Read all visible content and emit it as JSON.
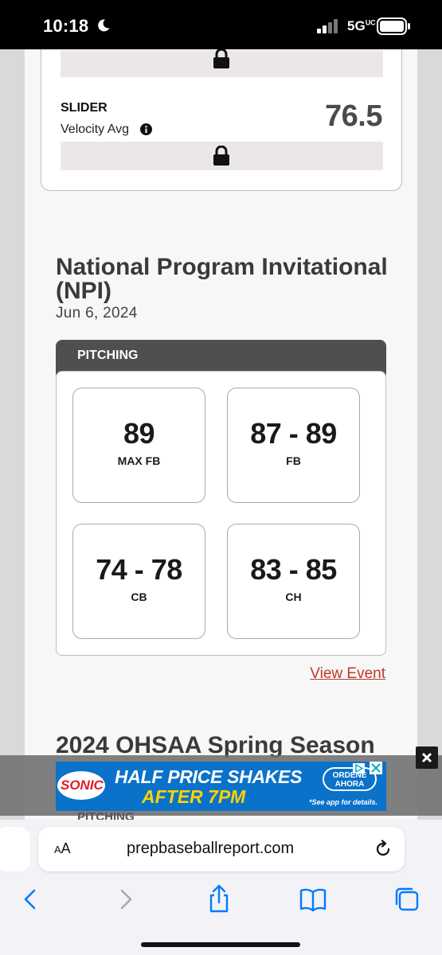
{
  "status_bar": {
    "time": "10:18",
    "network": "5G",
    "network_superscript": "UC"
  },
  "slider_metric": {
    "name": "SLIDER",
    "subtitle": "Velocity Avg",
    "value": "76.5"
  },
  "event": {
    "title": "National Program Invitational (NPI)",
    "date": "Jun 6, 2024",
    "section_label": "PITCHING",
    "stats": [
      {
        "value": "89",
        "label": "MAX FB"
      },
      {
        "value": "87 - 89",
        "label": "FB"
      },
      {
        "value": "74 - 78",
        "label": "CB"
      },
      {
        "value": "83 - 85",
        "label": "CH"
      }
    ],
    "link_label": "View Event"
  },
  "next_event": {
    "title": "2024 OHSAA Spring Season",
    "section_label_partial": "PITCHING"
  },
  "ad": {
    "brand": "SONIC",
    "headline": "HALF PRICE SHAKES",
    "subline": "AFTER 7PM",
    "cta_line1": "ORDENE",
    "cta_line2": "AHORA",
    "note": "*See app for details."
  },
  "browser": {
    "text_size_label_small": "A",
    "text_size_label": "A",
    "url": "prepbaseballreport.com"
  },
  "colors": {
    "link": "#c0392b",
    "header_bg": "#4f4f4f",
    "ad_bg": "#0a72c9",
    "ad_accent": "#ffd200",
    "accent_blue": "#007aff"
  }
}
